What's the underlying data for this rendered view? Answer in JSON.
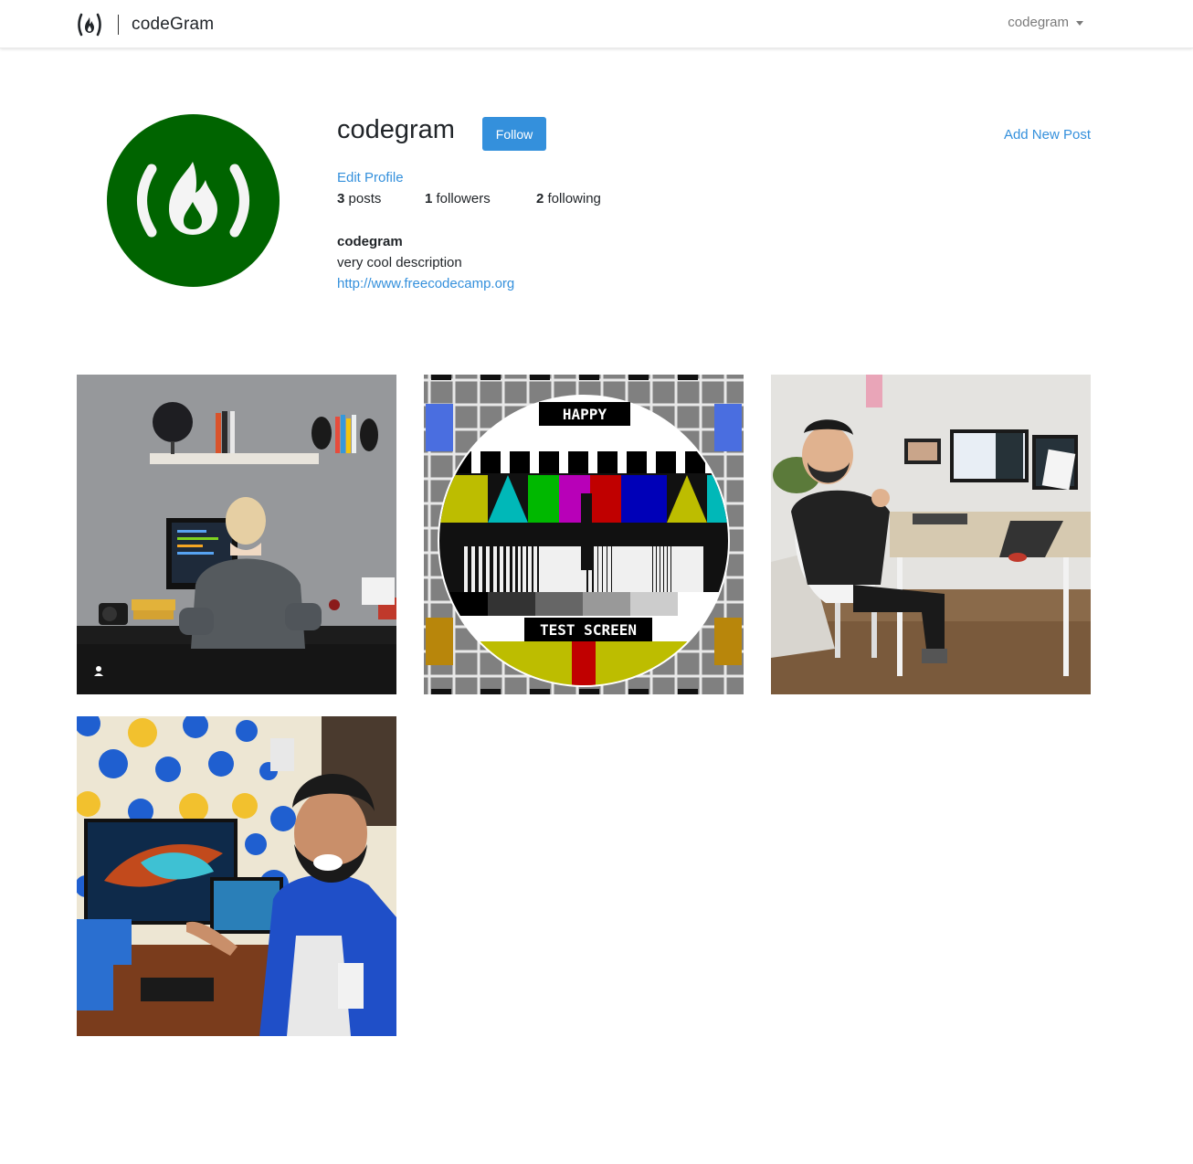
{
  "navbar": {
    "brand_name": "codeGram",
    "user_menu_label": "codegram"
  },
  "profile": {
    "username": "codegram",
    "follow_label": "Follow",
    "add_post_label": "Add New Post",
    "edit_profile_label": "Edit Profile",
    "stats": {
      "posts_count": "3",
      "posts_label": "posts",
      "followers_count": "1",
      "followers_label": "followers",
      "following_count": "2",
      "following_label": "following"
    },
    "bio": {
      "title": "codegram",
      "description": "very cool description",
      "url": "http://www.freecodecamp.org"
    },
    "avatar_color": "#006400"
  },
  "posts": [
    {
      "alt": "woman coding at desk"
    },
    {
      "alt": "happy test screen",
      "caption_top": "HAPPY",
      "caption_bottom": "TEST SCREEN"
    },
    {
      "alt": "man at desk with monitors"
    },
    {
      "alt": "smiling man with laptop"
    }
  ],
  "colors": {
    "accent": "#3490dc",
    "text": "#212529",
    "muted": "#7a7a7a"
  }
}
